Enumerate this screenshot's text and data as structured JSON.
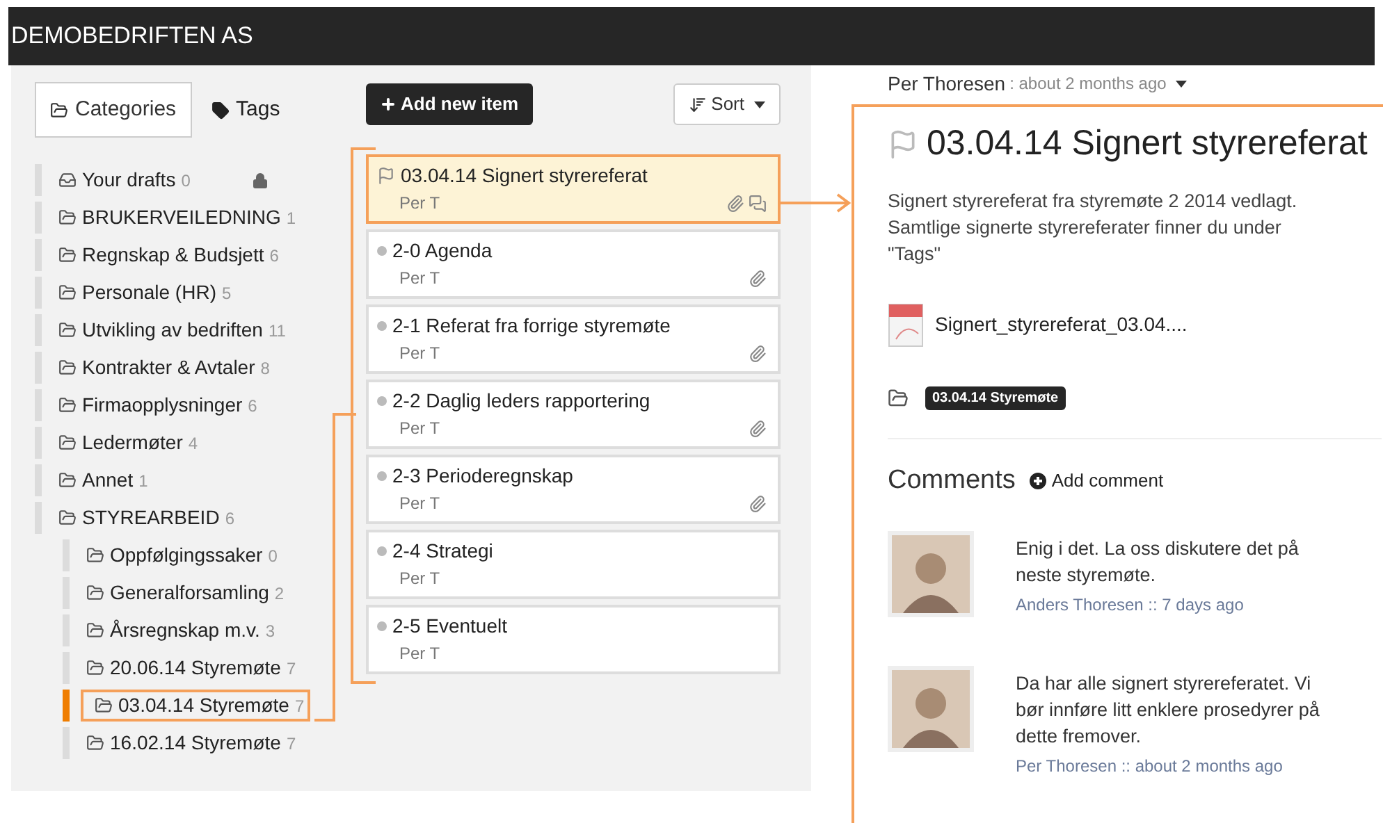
{
  "header": {
    "title": "DEMOBEDRIFTEN AS"
  },
  "sidebar_tabs": [
    {
      "label": "Categories",
      "kind": "folder",
      "selected": true
    },
    {
      "label": "Tags",
      "kind": "tag",
      "selected": false
    }
  ],
  "categories": [
    {
      "kind": "drafts",
      "name": "Your drafts",
      "count": "0",
      "locked": true,
      "selected": false
    },
    {
      "kind": "folder",
      "name": "BRUKERVEILEDNING",
      "count": "1",
      "locked": false,
      "selected": false
    },
    {
      "kind": "folder",
      "name": "Regnskap & Budsjett",
      "count": "6",
      "locked": false,
      "selected": false
    },
    {
      "kind": "folder",
      "name": "Personale (HR)",
      "count": "5",
      "locked": false,
      "selected": false
    },
    {
      "kind": "folder",
      "name": "Utvikling av bedriften",
      "count": "11",
      "locked": false,
      "selected": false
    },
    {
      "kind": "folder",
      "name": "Kontrakter & Avtaler",
      "count": "8",
      "locked": false,
      "selected": false
    },
    {
      "kind": "folder",
      "name": "Firmaopplysninger",
      "count": "6",
      "locked": false,
      "selected": false
    },
    {
      "kind": "folder",
      "name": "Ledermøter",
      "count": "4",
      "locked": false,
      "selected": false
    },
    {
      "kind": "folder",
      "name": "Annet",
      "count": "1",
      "locked": false,
      "selected": false
    },
    {
      "kind": "folder",
      "name": "STYREARBEID",
      "count": "6",
      "locked": false,
      "selected": false,
      "children": [
        {
          "kind": "folder",
          "name": "Oppfølgingssaker",
          "count": "0",
          "locked": false,
          "selected": false
        },
        {
          "kind": "folder",
          "name": "Generalforsamling",
          "count": "2",
          "locked": false,
          "selected": false
        },
        {
          "kind": "folder",
          "name": "Årsregnskap m.v.",
          "count": "3",
          "locked": false,
          "selected": false
        },
        {
          "kind": "folder",
          "name": "20.06.14 Styremøte",
          "count": "7",
          "locked": false,
          "selected": false
        },
        {
          "kind": "folder",
          "name": "03.04.14 Styremøte",
          "count": "7",
          "locked": false,
          "selected": true
        },
        {
          "kind": "folder",
          "name": "16.02.14 Styremøte",
          "count": "7",
          "locked": false,
          "selected": false
        }
      ]
    }
  ],
  "toolbar": {
    "add_button": "Add new item",
    "sort_button": "Sort"
  },
  "items": [
    {
      "kind": "flag",
      "title": "03.04.14 Signert styrereferat",
      "author": "Per T",
      "attachment": true,
      "comments": true,
      "selected": true
    },
    {
      "kind": "dot",
      "title": "2-0 Agenda",
      "author": "Per T",
      "attachment": true,
      "comments": false,
      "selected": false
    },
    {
      "kind": "dot",
      "title": "2-1 Referat fra forrige styremøte",
      "author": "Per T",
      "attachment": true,
      "comments": false,
      "selected": false
    },
    {
      "kind": "dot",
      "title": "2-2 Daglig leders rapportering",
      "author": "Per T",
      "attachment": true,
      "comments": false,
      "selected": false
    },
    {
      "kind": "dot",
      "title": "2-3 Perioderegnskap",
      "author": "Per T",
      "attachment": true,
      "comments": false,
      "selected": false
    },
    {
      "kind": "dot",
      "title": "2-4 Strategi",
      "author": "Per T",
      "attachment": false,
      "comments": false,
      "selected": false
    },
    {
      "kind": "dot",
      "title": "2-5 Eventuelt",
      "author": "Per T",
      "attachment": false,
      "comments": false,
      "selected": false
    }
  ],
  "detail": {
    "author": "Per Thoresen",
    "time": ": about 2 months ago",
    "title": "03.04.14 Signert styrereferat",
    "description": "Signert styrereferat fra styremøte 2 2014 vedlagt. Samtlige signerte styrereferater finner du under \"Tags\"",
    "attachment": "Signert_styrereferat_03.04....",
    "tag": "03.04.14 Styremøte"
  },
  "comments": {
    "title": "Comments",
    "add_button": "Add comment",
    "items": [
      {
        "text": "Enig i det. La oss diskutere det på neste styremøte.",
        "meta": "Anders Thoresen :: 7 days ago"
      },
      {
        "text": "Da har alle signert styrereferatet. Vi bør innføre litt enklere prosedyrer på dette fremover.",
        "meta": "Per Thoresen :: about 2 months ago"
      }
    ]
  }
}
